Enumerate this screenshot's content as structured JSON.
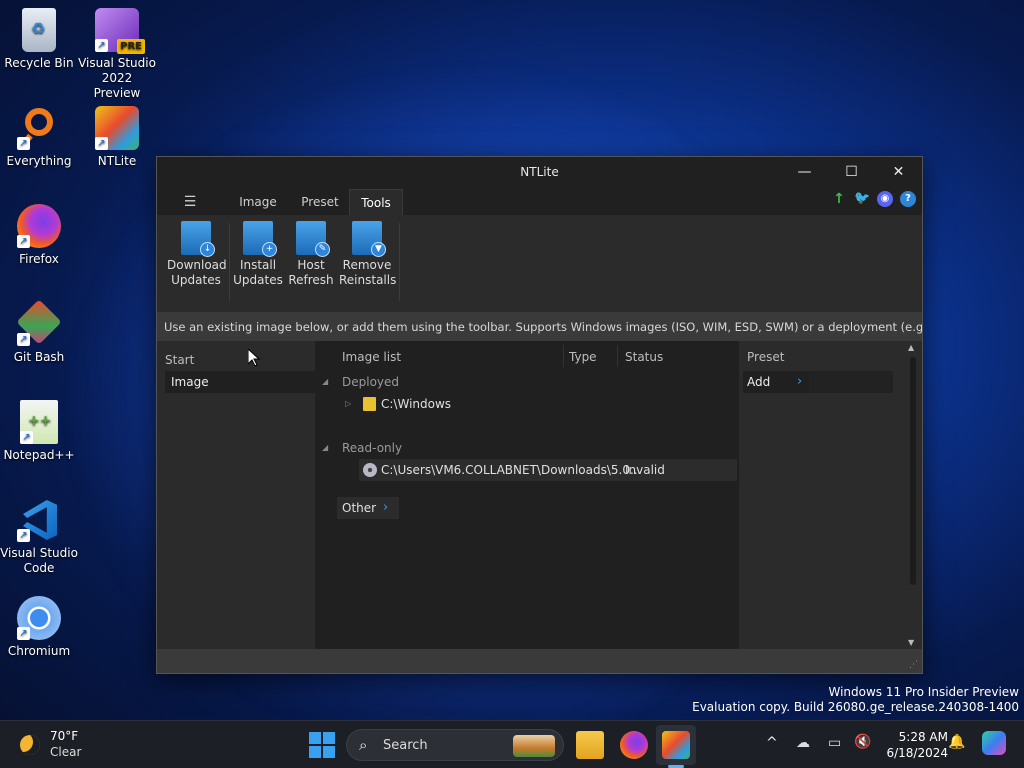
{
  "desktop": {
    "icons": [
      {
        "label": "Recycle Bin"
      },
      {
        "label": "Visual Studio 2022 Preview"
      },
      {
        "label": "Everything"
      },
      {
        "label": "NTLite"
      },
      {
        "label": "Firefox"
      },
      {
        "label": "Git Bash"
      },
      {
        "label": "Notepad++"
      },
      {
        "label": "Visual Studio Code"
      },
      {
        "label": "Chromium"
      }
    ],
    "vs_badge": "PRE",
    "watermark": {
      "line1": "Windows 11 Pro Insider Preview",
      "line2": "Evaluation copy. Build 26080.ge_release.240308-1400"
    }
  },
  "window": {
    "title": "NTLite",
    "controls": {
      "minimize": "—",
      "maximize": "☐",
      "close": "✕"
    },
    "tabs": {
      "menu": "☰",
      "image": "Image",
      "preset": "Preset",
      "tools": "Tools"
    },
    "ribbon": {
      "download_updates": {
        "line1": "Download",
        "line2": "Updates"
      },
      "install_updates": {
        "line1": "Install",
        "line2": "Updates"
      },
      "host_refresh": {
        "line1": "Host",
        "line2": "Refresh"
      },
      "remove_reinstalls": {
        "line1": "Remove",
        "line2": "Reinstalls"
      }
    },
    "info_text": "Use an existing image below, or add them using the toolbar. Supports Windows images (ISO, WIM, ESD, SWM) or a deployment (e.g. C:\\Wind...",
    "left_pane": {
      "header": "Start",
      "item": "Image"
    },
    "image_list": {
      "columns": {
        "name": "Image list",
        "type": "Type",
        "status": "Status"
      },
      "groups": {
        "deployed": "Deployed",
        "readonly": "Read-only"
      },
      "rows": {
        "windows": "C:\\Windows",
        "iso_path": "C:\\Users\\VM6.COLLABNET\\Downloads\\5.0...",
        "iso_status": "Invalid"
      },
      "other": "Other"
    },
    "preset_pane": {
      "header": "Preset",
      "add": "Add"
    }
  },
  "taskbar": {
    "weather": {
      "temp": "70°F",
      "condition": "Clear"
    },
    "search_label": "Search",
    "clock": {
      "time": "5:28 AM",
      "date": "6/18/2024"
    },
    "tray_chevron": "^"
  }
}
